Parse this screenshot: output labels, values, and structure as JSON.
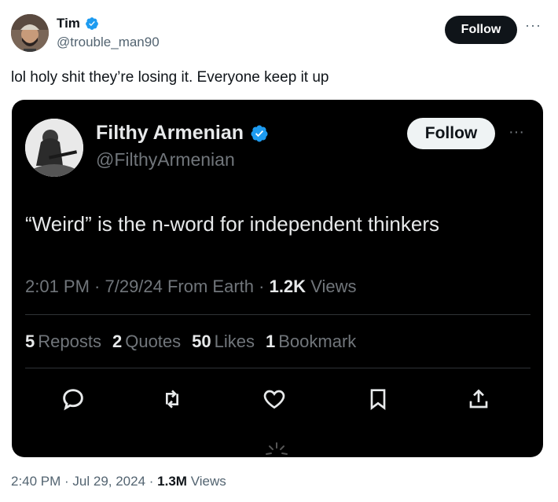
{
  "author": {
    "name": "Tim",
    "handle": "@trouble_man90"
  },
  "follow_label": "Follow",
  "more_label": "···",
  "post_text": "lol holy shit they’re losing it. Everyone keep it up",
  "quoted": {
    "name": "Filthy Armenian",
    "handle": "@FilthyArmenian",
    "follow_label": "Follow",
    "more_label": "···",
    "text": "“Weird” is the n-word for independent thinkers",
    "meta_prefix": "2:01 PM · 7/29/24 From Earth · ",
    "views_count": "1.2K",
    "views_label": "Views",
    "stats": [
      {
        "count": "5",
        "label": "Reposts"
      },
      {
        "count": "2",
        "label": "Quotes"
      },
      {
        "count": "50",
        "label": "Likes"
      },
      {
        "count": "1",
        "label": "Bookmark"
      }
    ]
  },
  "footer": {
    "timestamp": "2:40 PM · Jul 29, 2024 · ",
    "views_count": "1.3M",
    "views_label": "Views"
  },
  "colors": {
    "verified": "#1d9bf0",
    "text_primary": "#0f1419",
    "text_secondary": "#536471",
    "embed_bg": "#000000",
    "embed_muted": "#71767b"
  }
}
